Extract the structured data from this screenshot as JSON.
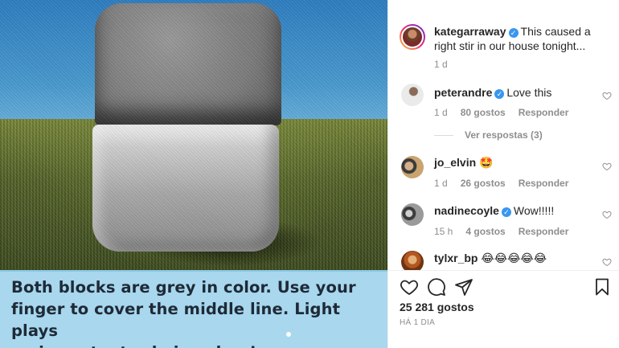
{
  "media": {
    "caption": "Both blocks are grey in color. Use your\nfinger to cover the middle line. Light plays\nan important role in colors!"
  },
  "post": {
    "author": "kategarraway",
    "author_verified": true,
    "text": "This caused a right stir in our house tonight...",
    "time": "1 d"
  },
  "comments": [
    {
      "user": "peterandre",
      "verified": true,
      "text": "Love this",
      "time": "1 d",
      "likes": "80 gostos",
      "reply": "Responder",
      "view_replies": "Ver respostas (3)"
    },
    {
      "user": "jo_elvin",
      "verified": false,
      "text": "🤩",
      "time": "1 d",
      "likes": "26 gostos",
      "reply": "Responder"
    },
    {
      "user": "nadinecoyle",
      "verified": true,
      "text": "Wow!!!!!",
      "time": "15 h",
      "likes": "4 gostos",
      "reply": "Responder"
    },
    {
      "user": "tylxr_bp",
      "verified": false,
      "text": "😂😂😂😂😂",
      "time": "",
      "likes": "",
      "reply": ""
    }
  ],
  "footer": {
    "likes_count": "25 281 gostos",
    "age": "HÁ 1 DIA"
  },
  "icons": {
    "like": "heart-icon",
    "comment": "comment-bubble-icon",
    "share": "paper-plane-icon",
    "save": "bookmark-icon"
  },
  "colors": {
    "verified": "#3897f0",
    "muted": "#8e8e8e",
    "text": "#262626"
  }
}
